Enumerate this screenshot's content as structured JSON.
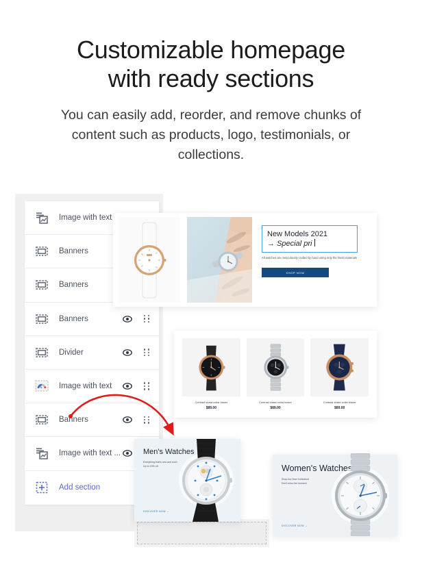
{
  "header": {
    "title_line1": "Customizable homepage",
    "title_line2": "with ready sections",
    "subtitle": "You can easily add, reorder, and remove chunks of content such as products, logo, testimonials, or collections."
  },
  "sidebar": {
    "items": [
      {
        "label": "Image with text ...",
        "icon": "image-with-text-icon",
        "controls_visible": false
      },
      {
        "label": "Banners",
        "icon": "banner-icon",
        "controls_visible": false
      },
      {
        "label": "Banners",
        "icon": "banner-icon",
        "controls_visible": false
      },
      {
        "label": "Banners",
        "icon": "banner-icon",
        "controls_visible": true
      },
      {
        "label": "Divider",
        "icon": "banner-icon",
        "controls_visible": true
      },
      {
        "label": "Image with text",
        "icon": "gauge-image-icon",
        "controls_visible": true
      },
      {
        "label": "Banners",
        "icon": "banner-icon",
        "controls_visible": true
      },
      {
        "label": "Image with text ...",
        "icon": "image-with-text-icon",
        "controls_visible": true
      }
    ],
    "add_section_label": "Add section",
    "add_section_color": "#5c6ac4"
  },
  "preview": {
    "hero": {
      "headline_line1": "New Models 2021",
      "headline_line2": "Special pri",
      "arrow_glyph": "→",
      "body": "All watches are meticulously crafted by hand using only the finest materials",
      "button_label": "SHOP NOW",
      "button_color": "#154a80",
      "edit_border_color": "#3fa0e8"
    },
    "products": [
      {
        "name": "Contrast shawl collar blazer",
        "price": "$89.00"
      },
      {
        "name": "Contrast shawl collar blazer",
        "price": "$89.00"
      },
      {
        "name": "Contrast shawl collar blazer",
        "price": "$89.00"
      }
    ],
    "mens_card": {
      "title": "Men's Watches",
      "sub_line1": "Everything that's new and now!",
      "sub_line2": "Up to 15% off",
      "link": "DISCOVER NOW  →"
    },
    "womens_card": {
      "title": "Women's Watches",
      "sub_line1": "Shop the New Collection!",
      "sub_line2": "Don't miss the moment",
      "link": "DISCOVER NOW  →"
    }
  },
  "annotation": {
    "arrow_color": "#e01b1b"
  }
}
